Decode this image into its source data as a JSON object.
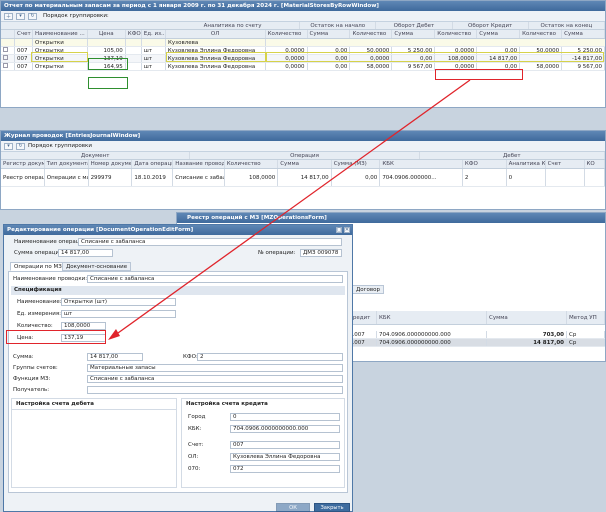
{
  "report": {
    "title": "Отчет по материальным запасам за период с 1 января 2009 г. по 31 декабря 2024 г. [MaterialStoresByRowWindow]",
    "group_label": "Порядок группировки:",
    "groups": [
      "Аналитика по счету",
      "Остаток на начало",
      "Оборот Дебет",
      "Оборот Кредит",
      "Остаток на конец"
    ],
    "columns": [
      "Счет",
      "Наименование ...",
      "Цена",
      "КФО",
      "Ед. из...",
      "ОЛ",
      "Количество",
      "Сумма",
      "Количество",
      "Сумма",
      "Количество",
      "Сумма",
      "Количество",
      "Сумма"
    ],
    "filter_row": [
      "",
      "Открытки",
      "",
      "",
      "",
      "Кузовлева"
    ],
    "rows": [
      [
        "007",
        "Открытки",
        "105,00",
        "",
        "шт",
        "Кузовлева Эллина Федоровна",
        "0,0000",
        "0,00",
        "50,0000",
        "5 250,00",
        "0,0000",
        "0,00",
        "50,0000",
        "5 250,00"
      ],
      [
        "007",
        "Открытки",
        "137,19",
        "",
        "шт",
        "Кузовлева Эллина Федоровна",
        "0,0000",
        "0,00",
        "0,0000",
        "0,00",
        "108,0000",
        "14 817,00",
        "",
        "-14 817,00"
      ],
      [
        "007",
        "Открытки",
        "164,95",
        "",
        "шт",
        "Кузовлева Эллина Федоровна",
        "0,0000",
        "0,00",
        "58,0000",
        "9 567,00",
        "0,0000",
        "0,00",
        "58,0000",
        "9 567,00"
      ]
    ]
  },
  "journal": {
    "title": "Журнал проводок [EntriesJournalWindow]",
    "group_label": "Порядок группировки",
    "col_groups": [
      "Документ",
      "Операция",
      "Дебет"
    ],
    "columns": [
      "Регистр документа",
      "Тип документа",
      "Номер документа",
      "Дата операции",
      "Название провод...",
      "Количество",
      "Сумма",
      "Сумма (МЗ)",
      "КБК",
      "КФО",
      "Аналитика КФО",
      "Счет",
      "КО"
    ],
    "row": [
      "Реестр операций ...",
      "Операции с мате...",
      "299979",
      "18.10.2019",
      "Списание с забал...",
      "108,0000",
      "14 817,00",
      "0,00",
      "704.0906.000000...",
      "2",
      "0",
      "",
      ""
    ]
  },
  "mz": {
    "title": "Реестр операций с МЗ [MZOperationsForm]",
    "tab": "Договор",
    "columns": [
      "Кредит",
      "КБК",
      "Сумма",
      "Метод УП"
    ],
    "rows": [
      [
        "2.007",
        "704.0906.000000000.000",
        "703,00",
        "Ср"
      ],
      [
        "2.007",
        "704.0906.000000000.000",
        "14 817,00",
        "Ср"
      ]
    ]
  },
  "edit": {
    "title": "Редактирование операции [DocumentOperationEditForm]",
    "name_label": "Наименование операции:",
    "name_value": "Списание с забаланса",
    "sum_label": "Сумма операции:",
    "sum_value": "14 817,00",
    "num_label": "№ операции:",
    "num_value": "ДМЗ 009078",
    "tabs": [
      "Операции по МЗ",
      "Документ-основание"
    ],
    "entry_label": "Наименование проводки:",
    "entry_value": "Списание с забаланса",
    "spec_title": "Спецификация",
    "spec": [
      {
        "label": "Наименование:",
        "value": "Открытки (шт)"
      },
      {
        "label": "Ед. измерения:",
        "value": "шт"
      },
      {
        "label": "Количество:",
        "value": "108,0000"
      },
      {
        "label": "Цена:",
        "value": "137,19"
      }
    ],
    "sum2_label": "Сумма:",
    "sum2_value": "14 817,00",
    "kfo_label": "КФО:",
    "kfo_value": "2",
    "groups_label": "Группы счетов:",
    "groups_value": "Материальные запасы",
    "func_label": "Функция МЗ:",
    "func_value": "Списание с забаланса",
    "recv_label": "Получатель:",
    "debit_title": "Настройка счета дебета",
    "credit_title": "Настройка счета кредита",
    "credit": [
      {
        "label": "Город",
        "value": "0"
      },
      {
        "label": "КБК:",
        "value": "704.0906.0000000000.000"
      },
      {
        "label": "Счет:",
        "value": "007"
      },
      {
        "label": "ОЛ:",
        "value": "Кузовлева Эллина Федоровна"
      },
      {
        "label": "070:",
        "value": "072"
      }
    ],
    "buttons": [
      "ОК",
      "Закрыть"
    ]
  },
  "colors": {
    "highlight_red": "#e0242b",
    "highlight_green": "#2f8f2f",
    "title_blue": "#3f6a9c"
  }
}
